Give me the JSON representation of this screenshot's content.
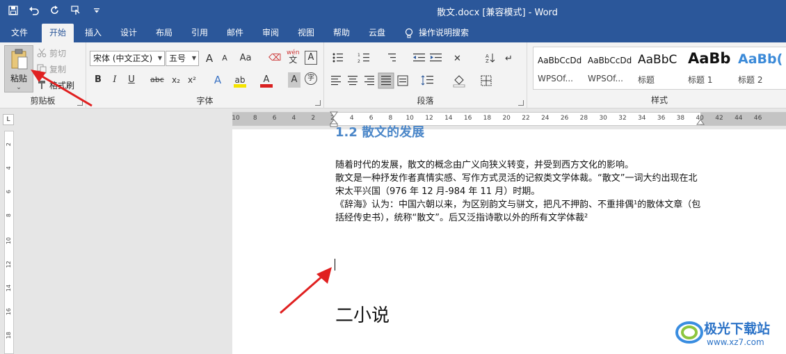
{
  "window": {
    "title": "散文.docx [兼容模式]  -  Word"
  },
  "qat": {
    "icons": [
      "save-icon",
      "undo-icon",
      "redo-icon",
      "touch-mode-icon",
      "customize-qat-icon"
    ]
  },
  "tabs": [
    "文件",
    "开始",
    "插入",
    "设计",
    "布局",
    "引用",
    "邮件",
    "审阅",
    "视图",
    "帮助",
    "云盘"
  ],
  "active_tab": "开始",
  "tell_me": "操作说明搜索",
  "clipboard": {
    "paste_label": "粘贴",
    "cut_label": "剪切",
    "copy_label": "复制",
    "format_painter_label": "格式刷",
    "group_label": "剪贴板"
  },
  "font": {
    "font_name": "宋体 (中文正文)",
    "font_size": "五号",
    "group_label": "字体",
    "buttons": {
      "grow": "A",
      "shrink": "A",
      "case": "Aa",
      "phonetic_top": "wén",
      "phonetic_bottom": "文",
      "border_char": "A",
      "bold": "B",
      "italic": "I",
      "underline": "U",
      "strike": "abc",
      "subscript": "x₂",
      "superscript": "x²",
      "effects": "A",
      "highlight": "ab",
      "color": "A",
      "shading": "A",
      "enclose": "字"
    }
  },
  "paragraph": {
    "group_label": "段落"
  },
  "styles": {
    "group_label": "样式",
    "items": [
      {
        "sample": "AaBbCcDd",
        "name": "WPSOf..."
      },
      {
        "sample": "AaBbCcDd",
        "name": "WPSOf..."
      },
      {
        "sample": "AaBbC",
        "name": "标题"
      },
      {
        "sample": "AaBb",
        "name": "标题 1"
      },
      {
        "sample": "AaBb(",
        "name": "标题 2"
      }
    ]
  },
  "ruler": {
    "corner": "L",
    "h_numbers": [
      "10",
      "8",
      "6",
      "4",
      "2",
      "2",
      "4",
      "6",
      "8",
      "10",
      "12",
      "14",
      "16",
      "18",
      "20",
      "22",
      "24",
      "26",
      "28",
      "30",
      "32",
      "34",
      "36",
      "38",
      "40",
      "42",
      "44",
      "46"
    ],
    "v_numbers": [
      "2",
      "4",
      "6",
      "8",
      "10",
      "12",
      "14",
      "16",
      "18"
    ]
  },
  "document": {
    "heading_partial": "1.2 散文的发展",
    "paragraphs": [
      "随着时代的发展，散文的概念由广义向狭义转变，并受到西方文化的影响。",
      "散文是一种抒发作者真情实感、写作方式灵活的记叙类文学体裁。“散文”一词大约出现在北宋太平兴国（976 年 12 月-984 年 11 月）时期。",
      "《辞海》认为：中国六朝以来，为区别韵文与骈文，把凡不押韵、不重排偶¹的散体文章（包括经传史书），统称“散文”。后又泛指诗歌以外的所有文学体裁²"
    ],
    "heading_2": "二小说"
  },
  "watermark": {
    "title": "极光下载站",
    "url": "www.xz7.com"
  },
  "colors": {
    "brand": "#2b579a",
    "arrow": "#e02020",
    "heading": "#4a86c8"
  }
}
